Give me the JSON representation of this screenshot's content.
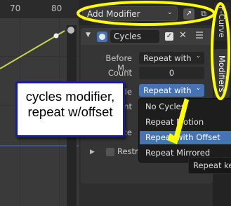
{
  "graph": {
    "ruler_ticks": [
      "70",
      "80"
    ],
    "curve_color": "#c4d64b",
    "handle_color": "#f0f0f0",
    "hline_color": "#3d5ea8"
  },
  "header": {
    "add_modifier_label": "Add Modifier",
    "link_icon": "link-icon",
    "copy_icon": "copy-icon"
  },
  "modifier": {
    "name": "Cycles",
    "enabled": true,
    "close_glyph": "✕",
    "check_glyph": "✓",
    "fields": {
      "before_mode_label": "Before M...",
      "before_mode_value": "Repeat with ...",
      "count_label": "Count",
      "count_value": "0",
      "after_mode_label_partial": "de",
      "after_mode_value": "Repeat with ...",
      "partial_label_1": "nt",
      "partial_label_2": "ce"
    },
    "restrict_label": "Restri"
  },
  "menu": {
    "items": [
      "No Cycles",
      "Repeat Motion",
      "Repeat with Offset",
      "Repeat Mirrored"
    ],
    "selected_index": 2
  },
  "tooltip": {
    "text": "Repeat ke"
  },
  "tabs": {
    "fcurve": "F-Curve",
    "modifiers": "Modifiers"
  },
  "annotation": {
    "callout_text": "cycles modifier, repeat w/offset",
    "accent_color": "#ffff00",
    "callout_border_color": "#1a1d96"
  }
}
